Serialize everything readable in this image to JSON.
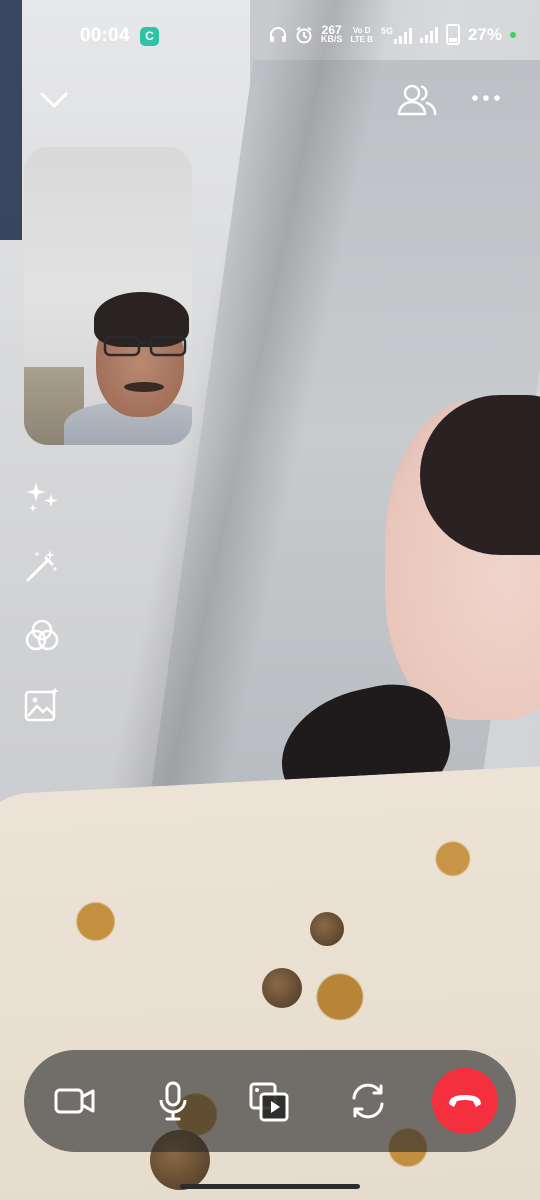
{
  "status_bar": {
    "time": "00:04",
    "app_badge": "C",
    "net_speed_value": "267",
    "net_speed_unit": "KB/S",
    "volte": "Vo D\nLTE B",
    "network": "5G",
    "battery": "27%"
  },
  "top_controls": {
    "collapse_icon": "chevron-down-icon",
    "participants_icon": "people-icon",
    "more_icon": "more-horizontal-icon"
  },
  "side_tools": [
    "sparkles-icon",
    "magic-wand-icon",
    "filters-icon",
    "background-image-icon"
  ],
  "call_bar": {
    "buttons": [
      "video-camera-icon",
      "microphone-icon",
      "share-media-icon",
      "switch-camera-icon",
      "end-call-icon"
    ]
  },
  "colors": {
    "end_call": "#f5303e",
    "bar_bg": "rgba(40,40,40,0.62)",
    "app_badge": "#2ec2a6",
    "status_dot": "#3fd35b"
  }
}
